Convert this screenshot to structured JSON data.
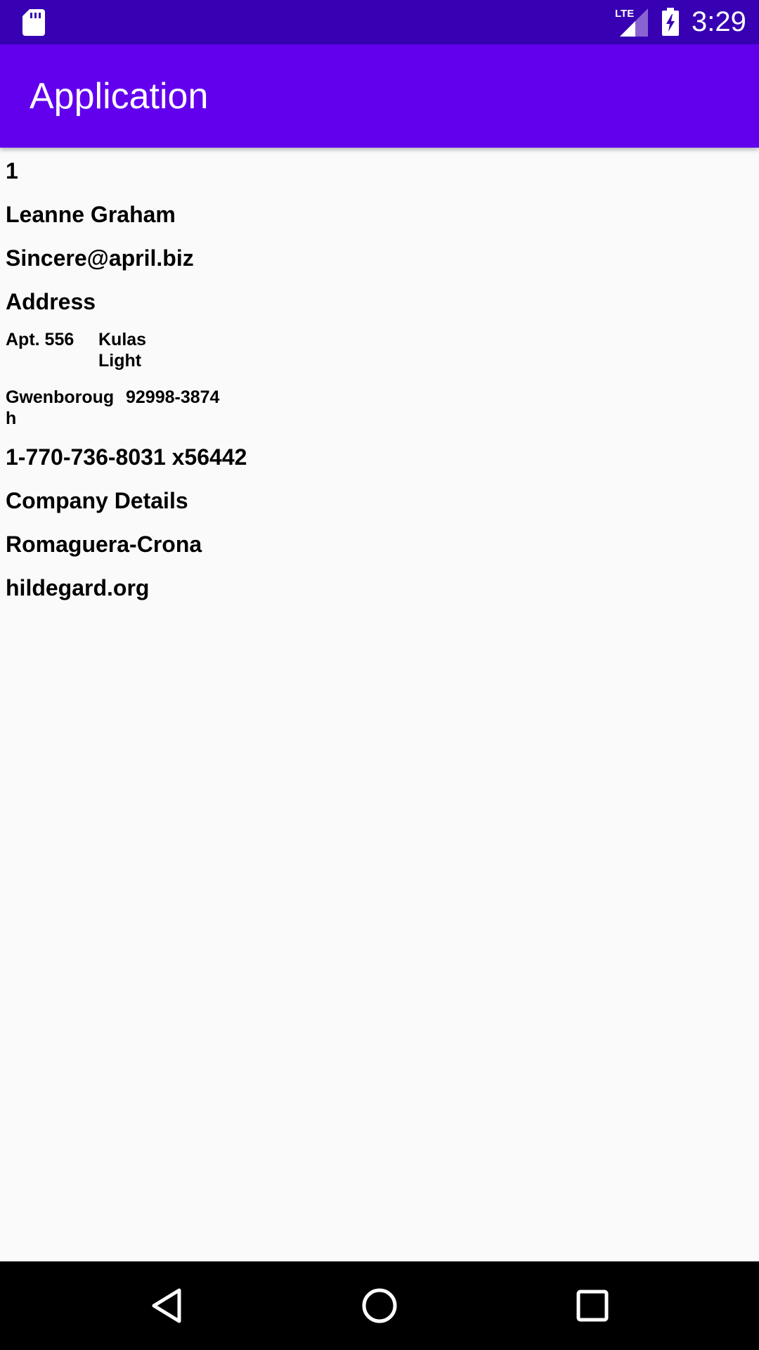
{
  "status_bar": {
    "time": "3:29",
    "network_label": "LTE",
    "icons": [
      "sd-card-icon",
      "lte-signal-icon",
      "battery-charging-icon"
    ],
    "background_color": "#3700b3"
  },
  "app_bar": {
    "title": "Application",
    "background_color": "#6200ee"
  },
  "user": {
    "id": "1",
    "name": "Leanne Graham",
    "email": "Sincere@april.biz",
    "address_heading": "Address",
    "address": {
      "suite": "Apt. 556",
      "street": "Kulas Light",
      "city": "Gwenborough",
      "zipcode": "92998-3874"
    },
    "phone": "1-770-736-8031 x56442",
    "company_heading": "Company Details",
    "company_name": "Romaguera-Crona",
    "website": "hildegard.org"
  },
  "nav_bar": {
    "buttons": [
      "back-icon",
      "home-icon",
      "recents-icon"
    ]
  }
}
